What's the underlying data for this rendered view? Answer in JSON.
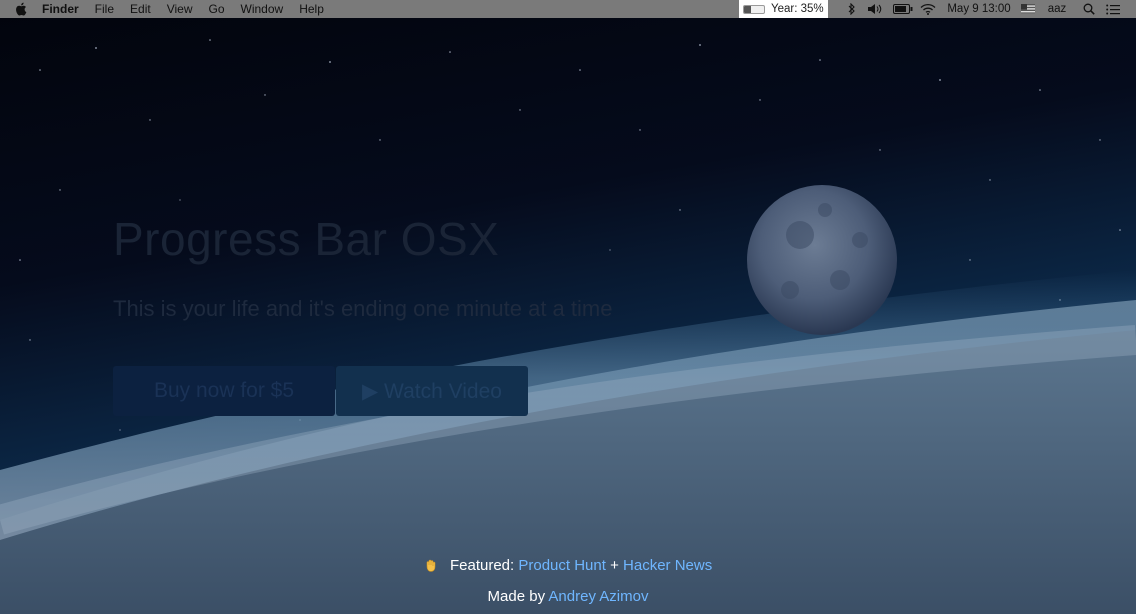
{
  "menubar": {
    "apple_icon": "apple-icon",
    "items": [
      {
        "label": "Finder"
      },
      {
        "label": "File"
      },
      {
        "label": "Edit"
      },
      {
        "label": "View"
      },
      {
        "label": "Go"
      },
      {
        "label": "Window"
      },
      {
        "label": "Help"
      }
    ],
    "year_widget": {
      "label": "Year: 35%",
      "progress_percent": 35
    },
    "status_icons": [
      "bluetooth-icon",
      "volume-icon",
      "battery-icon",
      "wifi-icon"
    ],
    "clock": "May 9  13:00",
    "flag_icon": "us-flag-icon",
    "user": "aaz",
    "search_icon": "spotlight-search-icon",
    "notification_icon": "notification-center-icon"
  },
  "hero": {
    "title": "Progress Bar OSX",
    "subtitle": "This is your life and it's ending one minute at a time",
    "buy_button": "Buy now for $5",
    "video_button": "▶ Watch Video"
  },
  "footer": {
    "featured_label": "Featured:",
    "product_hunt": "Product Hunt",
    "plus": "+",
    "hacker_news": "Hacker News",
    "made_by": "Made by",
    "author": "Andrey Azimov"
  }
}
